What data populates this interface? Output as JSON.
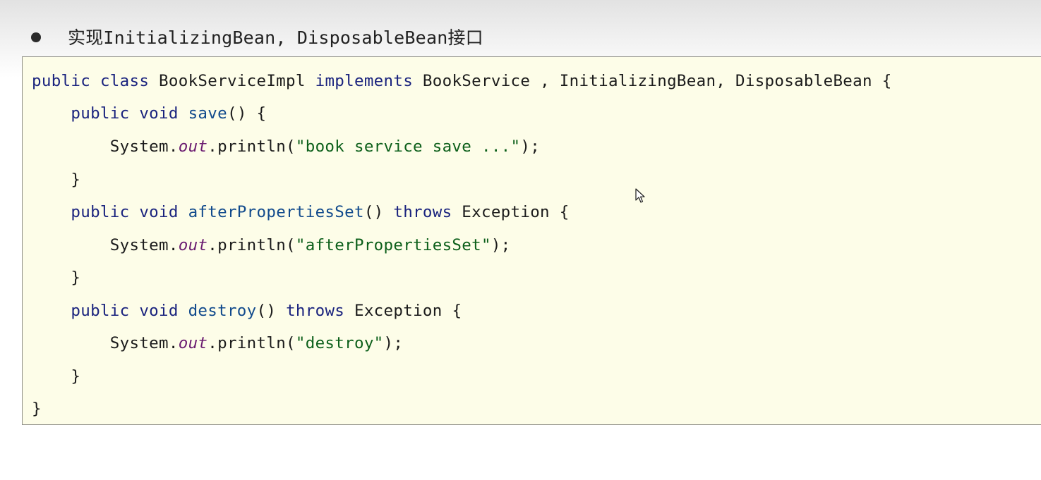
{
  "heading": {
    "bullet": "●",
    "text": "实现InitializingBean, DisposableBean接口"
  },
  "code": {
    "line1": {
      "kw1": "public",
      "kw2": "class",
      "name": "BookServiceImpl",
      "kw3": "implements",
      "rest": "BookService , InitializingBean, DisposableBean {"
    },
    "line2": {
      "indent": "    ",
      "kw1": "public",
      "kw2": "void",
      "method": "save",
      "rest": "() {"
    },
    "line3": {
      "indent": "        ",
      "obj": "System.",
      "field": "out",
      "call": ".println(",
      "str": "\"book service save ...\"",
      "end": ");"
    },
    "line4": {
      "text": "    }"
    },
    "line5": {
      "indent": "    ",
      "kw1": "public",
      "kw2": "void",
      "method": "afterPropertiesSet",
      "paren": "() ",
      "kw3": "throws",
      "rest": " Exception {"
    },
    "line6": {
      "indent": "        ",
      "obj": "System.",
      "field": "out",
      "call": ".println(",
      "str": "\"afterPropertiesSet\"",
      "end": ");"
    },
    "line7": {
      "text": "    }"
    },
    "line8": {
      "indent": "    ",
      "kw1": "public",
      "kw2": "void",
      "method": "destroy",
      "paren": "() ",
      "kw3": "throws",
      "rest": " Exception {"
    },
    "line9": {
      "indent": "        ",
      "obj": "System.",
      "field": "out",
      "call": ".println(",
      "str": "\"destroy\"",
      "end": ");"
    },
    "line10": {
      "text": "    }"
    },
    "line11": {
      "text": "}"
    }
  },
  "colors": {
    "code_background": "#fdfde8",
    "keyword": "#1a237e",
    "method": "#114a8c",
    "static_field": "#6a1b70",
    "string": "#0c5f1a"
  },
  "icons": {
    "cursor": "mouse-pointer-icon"
  }
}
